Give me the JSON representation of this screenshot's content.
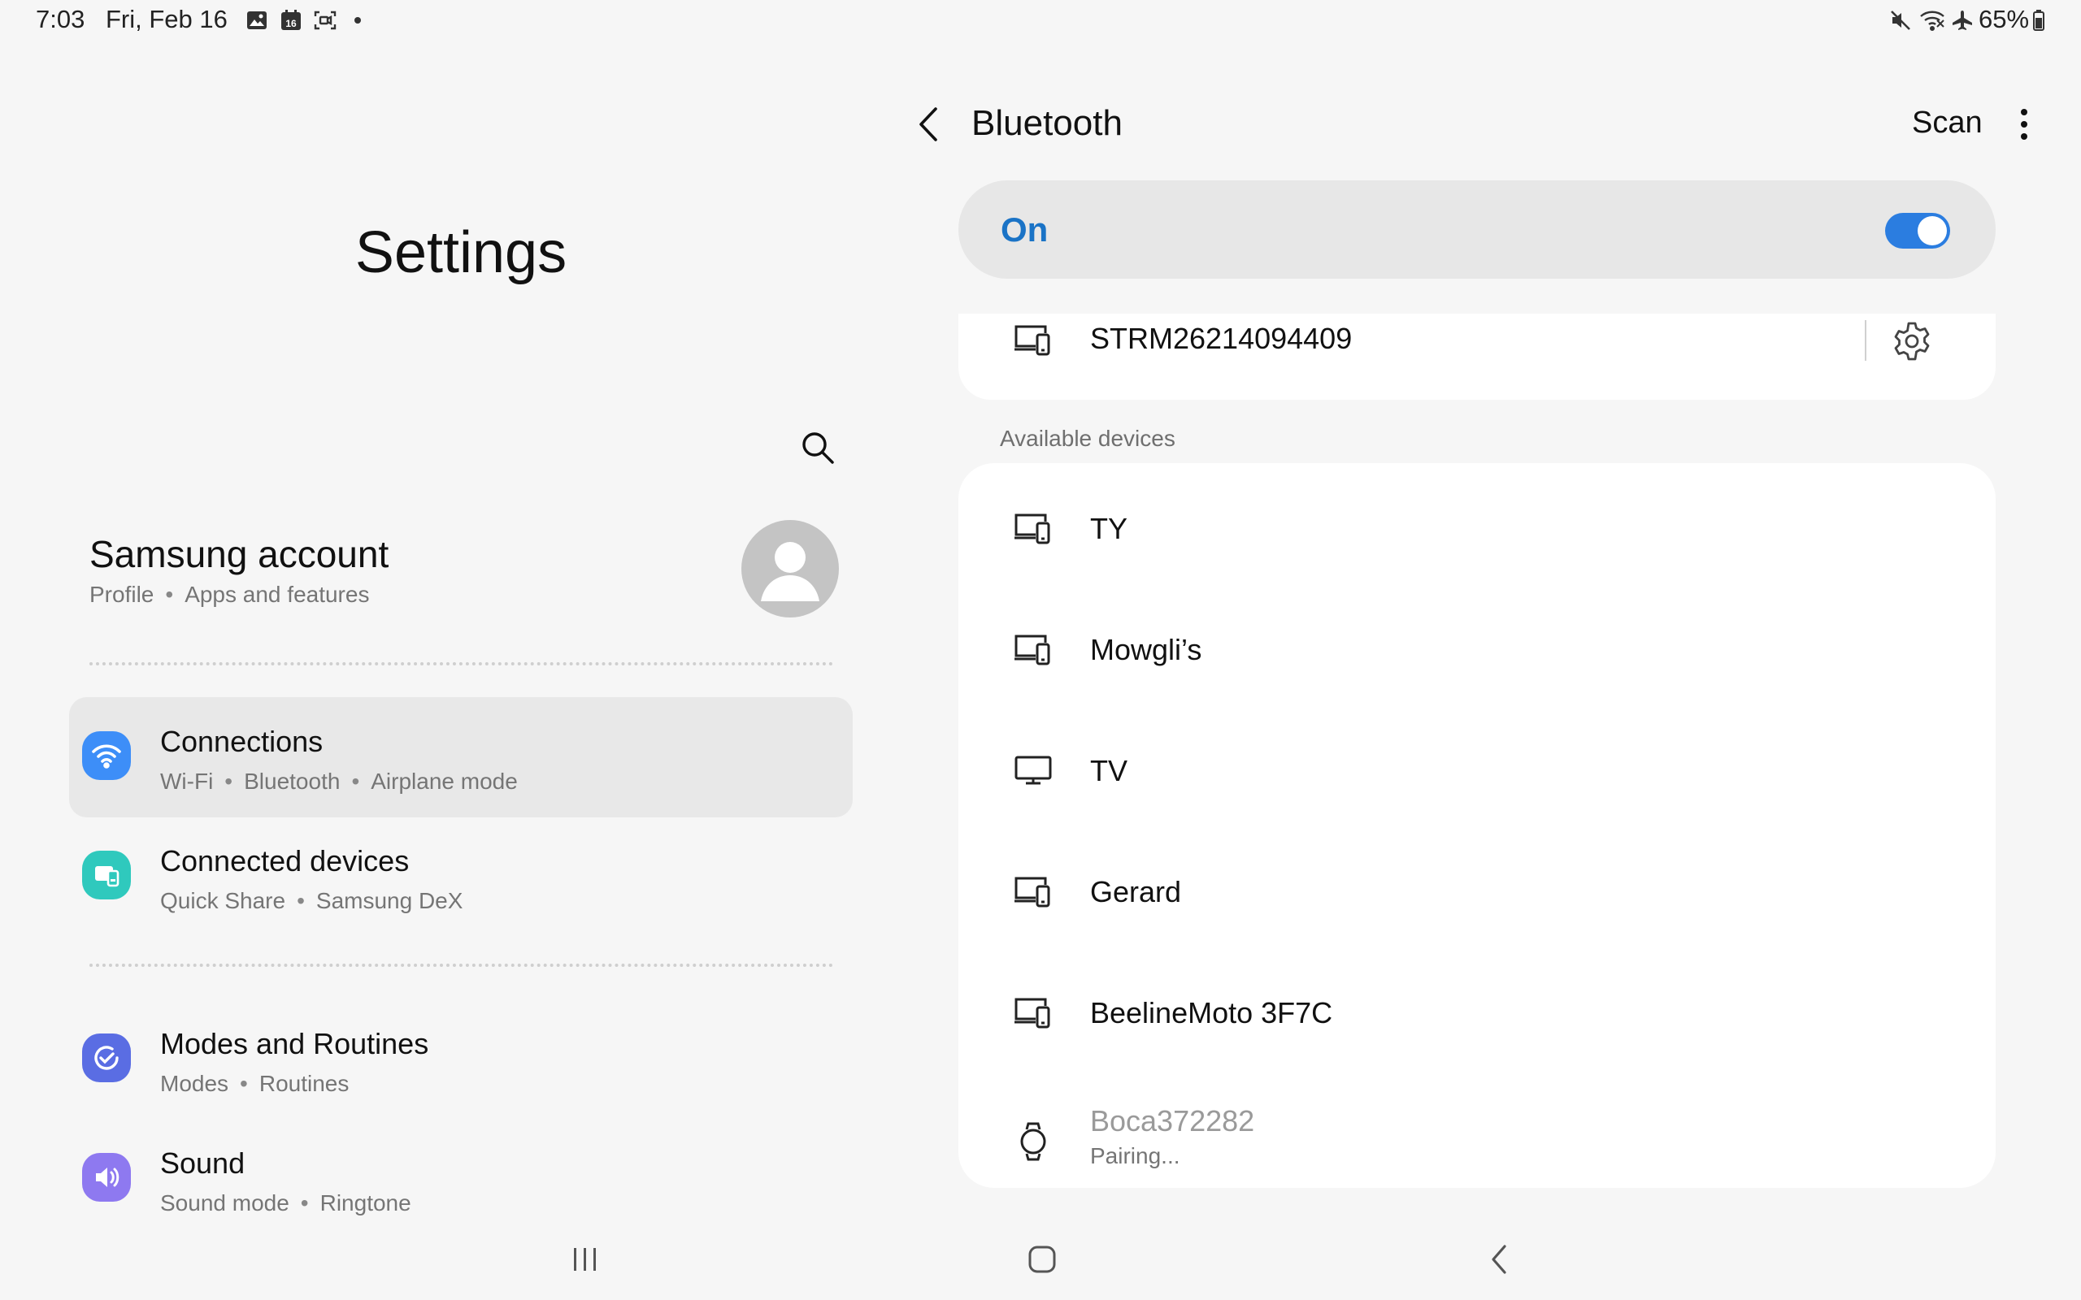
{
  "status_bar": {
    "time": "7:03",
    "date": "Fri, Feb 16",
    "left_icons": [
      "gallery-icon",
      "calendar-icon",
      "screen-recorder-icon",
      "dot-icon"
    ],
    "calendar_day": "16",
    "right_icons": [
      "mute-icon",
      "wifi-off-icon",
      "airplane-icon",
      "battery-icon"
    ],
    "battery": "65%"
  },
  "settings_pane": {
    "title": "Settings",
    "search_icon": "search-icon",
    "account": {
      "name": "Samsung account",
      "sub": [
        "Profile",
        "Apps and features"
      ]
    },
    "menu": [
      {
        "title": "Connections",
        "sub": [
          "Wi-Fi",
          "Bluetooth",
          "Airplane mode"
        ],
        "icon": "wifi-icon",
        "color": "#3d8ef8",
        "active": true
      },
      {
        "title": "Connected devices",
        "sub": [
          "Quick Share",
          "Samsung DeX"
        ],
        "icon": "connected-devices-icon",
        "color": "#2fc9bd",
        "active": false
      },
      {
        "title": "Modes and Routines",
        "sub": [
          "Modes",
          "Routines"
        ],
        "icon": "modes-routines-icon",
        "color": "#5a6de3",
        "active": false
      },
      {
        "title": "Sound",
        "sub": [
          "Sound mode",
          "Ringtone"
        ],
        "icon": "sound-icon",
        "color": "#8e79f0",
        "active": false
      }
    ]
  },
  "bluetooth_pane": {
    "title": "Bluetooth",
    "scan": "Scan",
    "toggle_label": "On",
    "toggle_on": true,
    "accent": "#2b7de0",
    "paired_device": {
      "name": "STRM26214094409",
      "icon": "phone-laptop-icon"
    },
    "available_header": "Available devices",
    "available_devices": [
      {
        "name": "TY",
        "icon": "phone-laptop-icon"
      },
      {
        "name": "Mowgli’s",
        "icon": "phone-laptop-icon"
      },
      {
        "name": "TV",
        "icon": "tv-icon"
      },
      {
        "name": "Gerard",
        "icon": "phone-laptop-icon"
      },
      {
        "name": "BeelineMoto 3F7C",
        "icon": "phone-laptop-icon"
      },
      {
        "name": "Boca372282",
        "icon": "watch-icon",
        "status": "Pairing..."
      }
    ]
  },
  "nav_bar": {
    "icons": [
      "recents-icon",
      "home-icon",
      "back-icon"
    ]
  }
}
